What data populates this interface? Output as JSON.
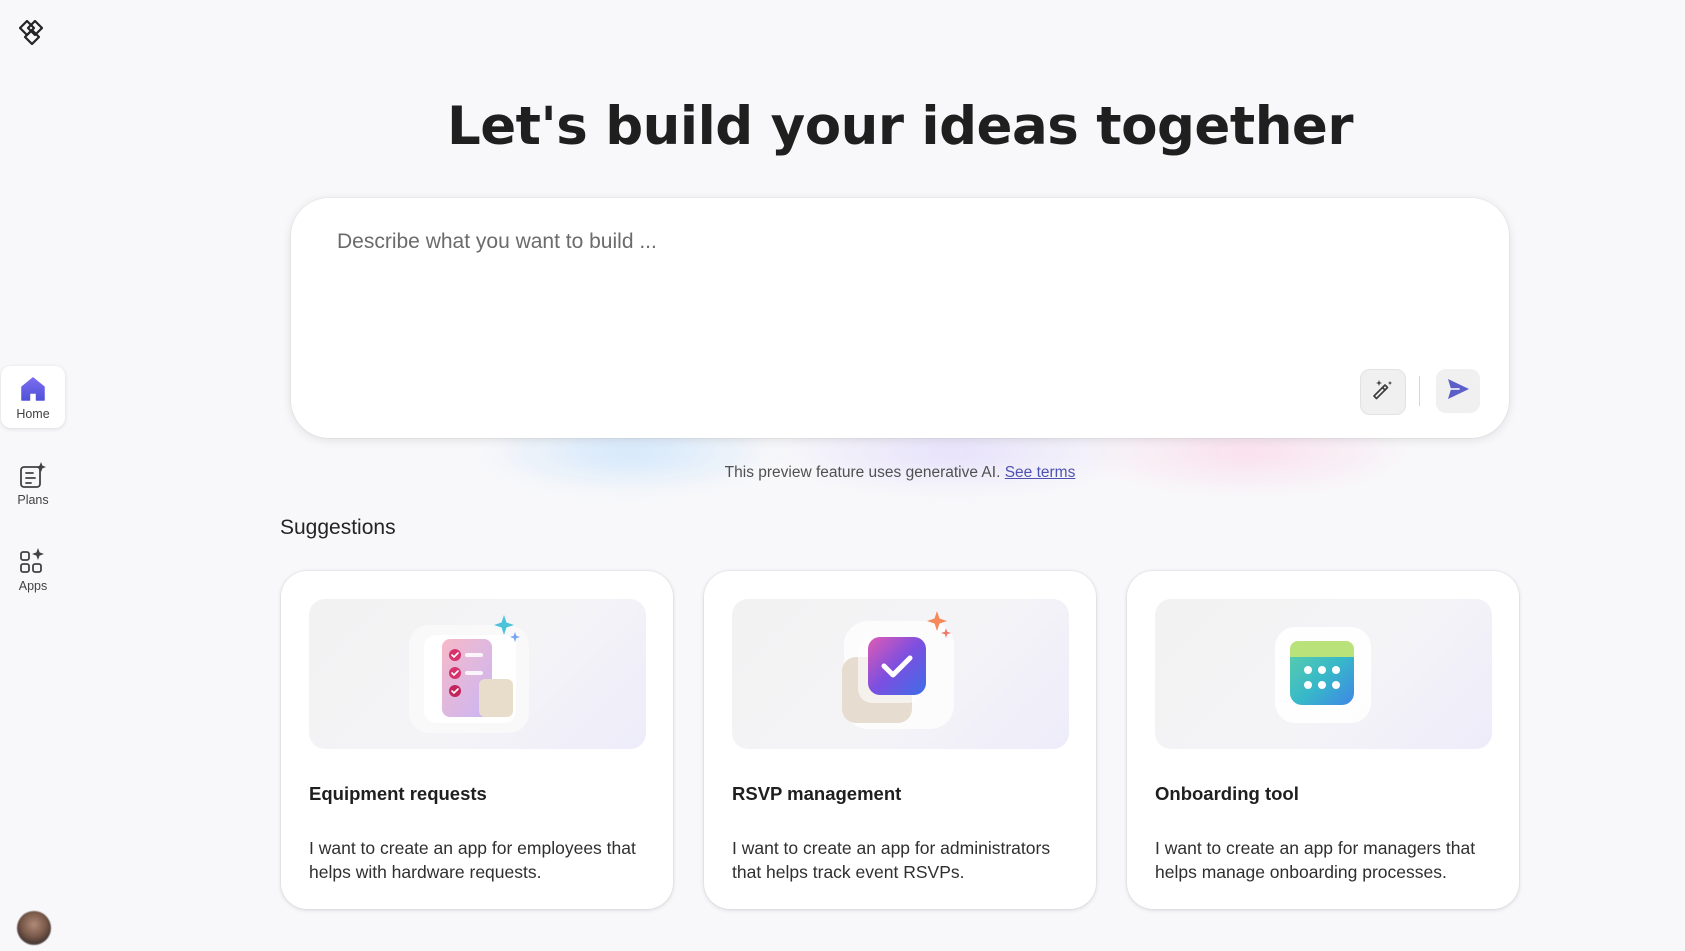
{
  "nav": {
    "logo_icon": "power-apps-logo-icon",
    "items": [
      {
        "label": "Home",
        "icon": "home-icon",
        "active": true
      },
      {
        "label": "Plans",
        "icon": "plans-icon",
        "active": false
      },
      {
        "label": "Apps",
        "icon": "apps-icon",
        "active": false
      }
    ],
    "avatar_icon": "user-avatar"
  },
  "main": {
    "headline": "Let's build your ideas together",
    "prompt": {
      "placeholder": "Describe what you want to build ...",
      "value": "",
      "enhance_icon": "magic-wand-icon",
      "send_icon": "send-icon"
    },
    "disclaimer": {
      "text": "This preview feature uses generative AI.",
      "link_label": "See terms"
    },
    "suggestions_title": "Suggestions",
    "suggestions": [
      {
        "title": "Equipment requests",
        "description": "I want to create an app for employees that helps with hardware requests.",
        "illustration": "checklist-illustration"
      },
      {
        "title": "RSVP management",
        "description": "I want to create an app for administrators that helps track event RSVPs.",
        "illustration": "checkmark-illustration"
      },
      {
        "title": "Onboarding tool",
        "description": "I want to create an app for managers that helps manage onboarding processes.",
        "illustration": "calendar-illustration"
      }
    ]
  },
  "colors": {
    "accent": "#5b5fc7",
    "background": "#f8f8fa",
    "link": "#4f52b2"
  }
}
